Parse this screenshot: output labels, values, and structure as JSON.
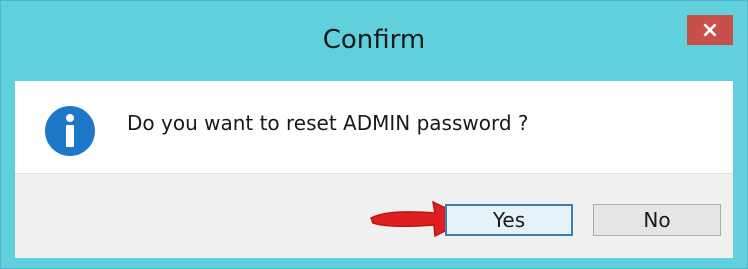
{
  "dialog": {
    "title": "Confirm",
    "close_glyph": "×",
    "message": "Do you want to reset ADMIN password ?",
    "icon": "info-icon",
    "buttons": {
      "yes_label": "Yes",
      "no_label": "No"
    }
  },
  "colors": {
    "titlebar": "#5fd0dc",
    "close_button": "#c7504b",
    "info_icon": "#1e78c8",
    "arrow": "#e02020",
    "default_button_border": "#3c7fb1"
  }
}
